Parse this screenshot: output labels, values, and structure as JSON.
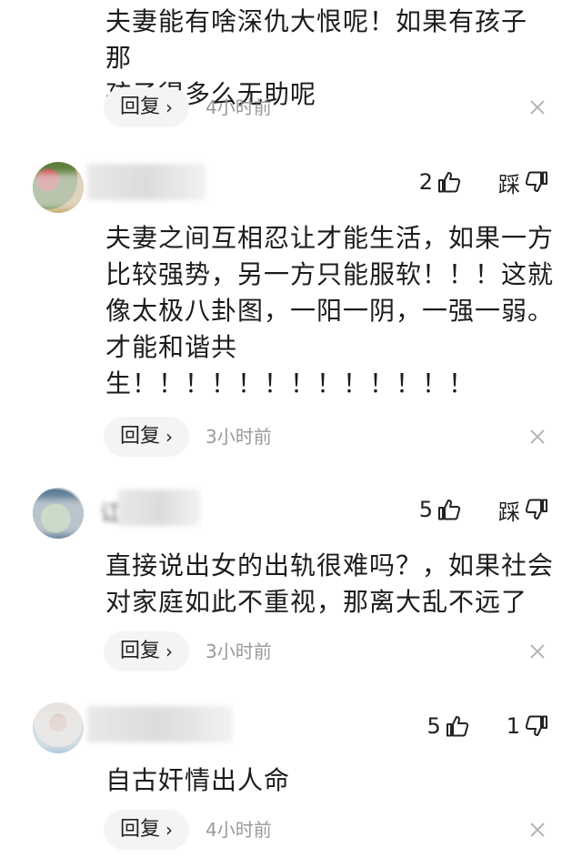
{
  "comments": [
    {
      "text_lines": [
        "夫妻能有啥深仇大恨呢！如果有孩子 那",
        "孩子得多么无助呢"
      ],
      "reply_label": "回复",
      "time": "4小时前"
    },
    {
      "username": "",
      "likes": "2",
      "dislike_label": "踩",
      "text_lines": [
        "夫妻之间互相忍让才能生活，如果一方",
        "比较强势，另一方只能服软！！！这就",
        "像太极八卦图，一阳一阴，一强一弱。",
        "才能和谐共",
        "生！！！！！！！！！！！！！"
      ],
      "reply_label": "回复",
      "time": "3小时前"
    },
    {
      "username": "讧",
      "likes": "5",
      "dislike_label": "踩",
      "text_lines": [
        "直接说出女的出轨很难吗？，如果社会",
        "对家庭如此不重视，那离大乱不远了"
      ],
      "reply_label": "回复",
      "time": "3小时前"
    },
    {
      "username": "",
      "likes": "5",
      "dislike_label": "1",
      "text_lines": [
        "自古奸情出人命"
      ],
      "reply_label": "回复",
      "time": "4小时前"
    }
  ],
  "icons": {
    "like": "thumbs-up-icon",
    "dislike": "thumbs-down-icon",
    "close": "close-icon",
    "reply_chevron": "chevron-right-icon"
  }
}
